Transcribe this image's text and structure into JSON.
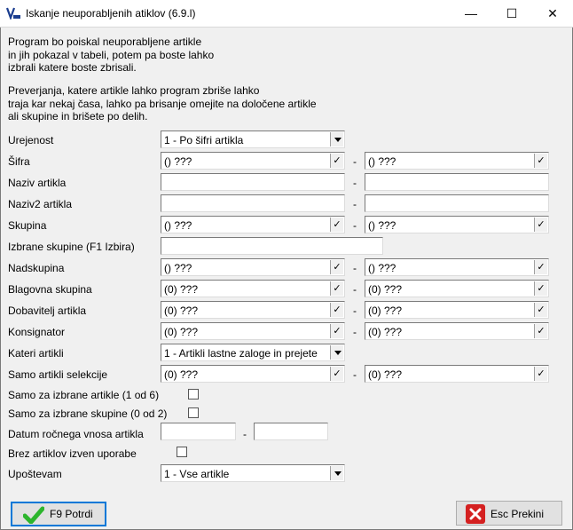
{
  "window": {
    "title": "Iskanje neuporabljenih atiklov  (6.9.l)",
    "minimize_glyph": "—",
    "maximize_glyph": "☐",
    "close_glyph": "✕"
  },
  "info": {
    "p1": "Program bo poiskal neuporabljene artikle\nin jih pokazal v tabeli, potem pa boste lahko\nizbrali katere boste zbrisali.",
    "p2": "Preverjanja, katere artikle lahko program zbriše lahko\ntraja kar nekaj časa, lahko pa brisanje omejite na določene artikle\nali skupine in brišete po delih."
  },
  "form": {
    "dash": "-",
    "check_glyph": "✓",
    "urejenost": {
      "label": "Urejenost",
      "value": "1 - Po šifri artikla"
    },
    "sifra": {
      "label": "Šifra",
      "from": "() ???",
      "to": "() ???"
    },
    "naziv": {
      "label": "Naziv artikla",
      "from": "",
      "to": ""
    },
    "naziv2": {
      "label": "Naziv2 artikla",
      "from": "",
      "to": ""
    },
    "skupina": {
      "label": "Skupina",
      "from": "() ???",
      "to": "() ???"
    },
    "izbrane_skupine": {
      "label": "Izbrane skupine (F1 Izbira)",
      "value": ""
    },
    "nadskupina": {
      "label": "Nadskupina",
      "from": "() ???",
      "to": "() ???"
    },
    "blagovna": {
      "label": "Blagovna skupina",
      "from": "(0) ???",
      "to": "(0) ???"
    },
    "dobavitelj": {
      "label": "Dobavitelj artikla",
      "from": "(0) ???",
      "to": "(0) ???"
    },
    "konsignator": {
      "label": "Konsignator",
      "from": "(0) ???",
      "to": "(0) ???"
    },
    "kateri": {
      "label": "Kateri artikli",
      "value": "1 - Artikli lastne zaloge in prejete"
    },
    "selekcije": {
      "label": "Samo artikli selekcije",
      "from": "(0) ???",
      "to": "(0) ???"
    },
    "izbrane_artikle": {
      "label": "Samo za izbrane artikle (1 od 6)"
    },
    "izbrane_skupine_cb": {
      "label": "Samo za izbrane skupine (0 od 2)"
    },
    "datum": {
      "label": "Datum ročnega vnosa artikla",
      "from": "",
      "to": ""
    },
    "brez": {
      "label": "Brez artiklov izven uporabe"
    },
    "upostevam": {
      "label": "Upoštevam",
      "value": "1 - Vse artikle"
    }
  },
  "buttons": {
    "confirm": "F9 Potrdi",
    "cancel": "Esc Prekini"
  },
  "colors": {
    "confirm_icon": "#2db52d",
    "cancel_icon": "#d42020"
  }
}
